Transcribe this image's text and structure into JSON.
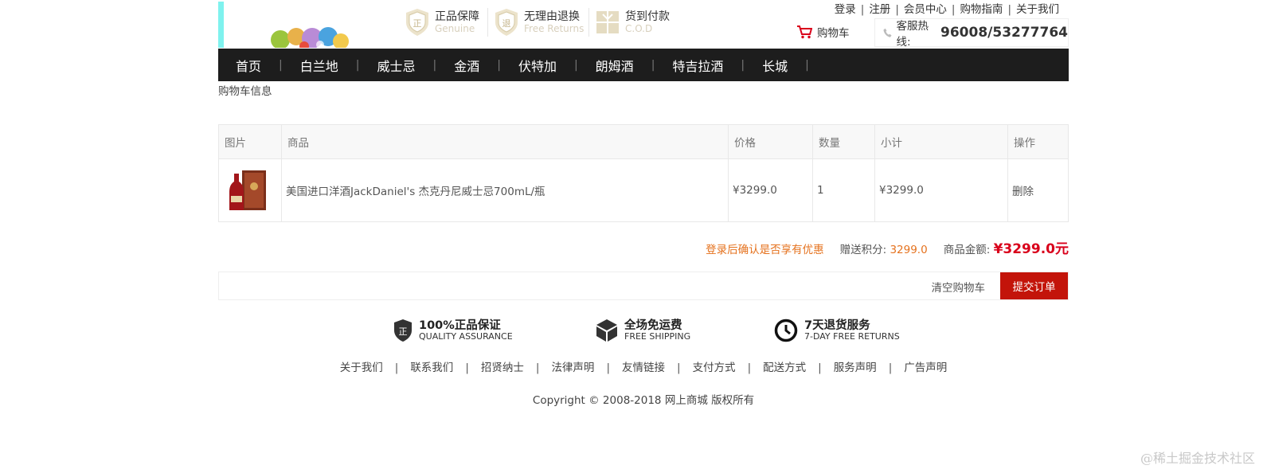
{
  "header": {
    "promises": [
      {
        "title": "正品保障",
        "sub": "Genuine",
        "icon": "genuine-shield-icon"
      },
      {
        "title": "无理由退换",
        "sub": "Free Returns",
        "icon": "returns-shield-icon"
      },
      {
        "title": "货到付款",
        "sub": "C.O.D",
        "icon": "cod-box-icon"
      }
    ],
    "top_links": [
      "登录",
      "注册",
      "会员中心",
      "购物指南",
      "关于我们"
    ],
    "cart_label": "购物车",
    "hotline_label": "客服热线:",
    "hotline_number": "96008/53277764"
  },
  "nav": {
    "items": [
      "首页",
      "白兰地",
      "威士忌",
      "金酒",
      "伏特加",
      "朗姆酒",
      "特吉拉酒",
      "长城"
    ]
  },
  "breadcrumb": "购物车信息",
  "cart_table": {
    "headers": [
      "图片",
      "商品",
      "价格",
      "数量",
      "小计",
      "操作"
    ],
    "rows": [
      {
        "name": "美国进口洋酒JackDaniel's 杰克丹尼威士忌700mL/瓶",
        "price": "¥3299.0",
        "qty": "1",
        "subtotal": "¥3299.0",
        "action": "删除"
      }
    ]
  },
  "summary": {
    "login_hint": "登录后确认是否享有优惠",
    "points_label": "赠送积分:",
    "points_value": "3299.0",
    "amount_label": "商品金额:",
    "amount_value": "¥3299.0元"
  },
  "actions": {
    "clear": "清空购物车",
    "submit": "提交订单"
  },
  "footer": {
    "guarantees": [
      {
        "title": "100%正品保证",
        "sub": "QUALITY ASSURANCE",
        "icon": "quality-shield-icon"
      },
      {
        "title": "全场免运费",
        "sub": "FREE SHIPPING",
        "icon": "shipping-box-icon"
      },
      {
        "title": "7天退货服务",
        "sub": "7-DAY FREE RETURNS",
        "icon": "clock-icon"
      }
    ],
    "links": [
      "关于我们",
      "联系我们",
      "招贤纳士",
      "法律声明",
      "友情链接",
      "支付方式",
      "配送方式",
      "服务声明",
      "广告声明"
    ],
    "copyright": "Copyright © 2008-2018 网上商城 版权所有"
  },
  "watermark": "@稀土掘金技术社区",
  "colors": {
    "nav_bg": "#1d1d1d",
    "accent_red": "#c3140a",
    "price_red": "#d9001b",
    "orange": "#e5721e"
  }
}
